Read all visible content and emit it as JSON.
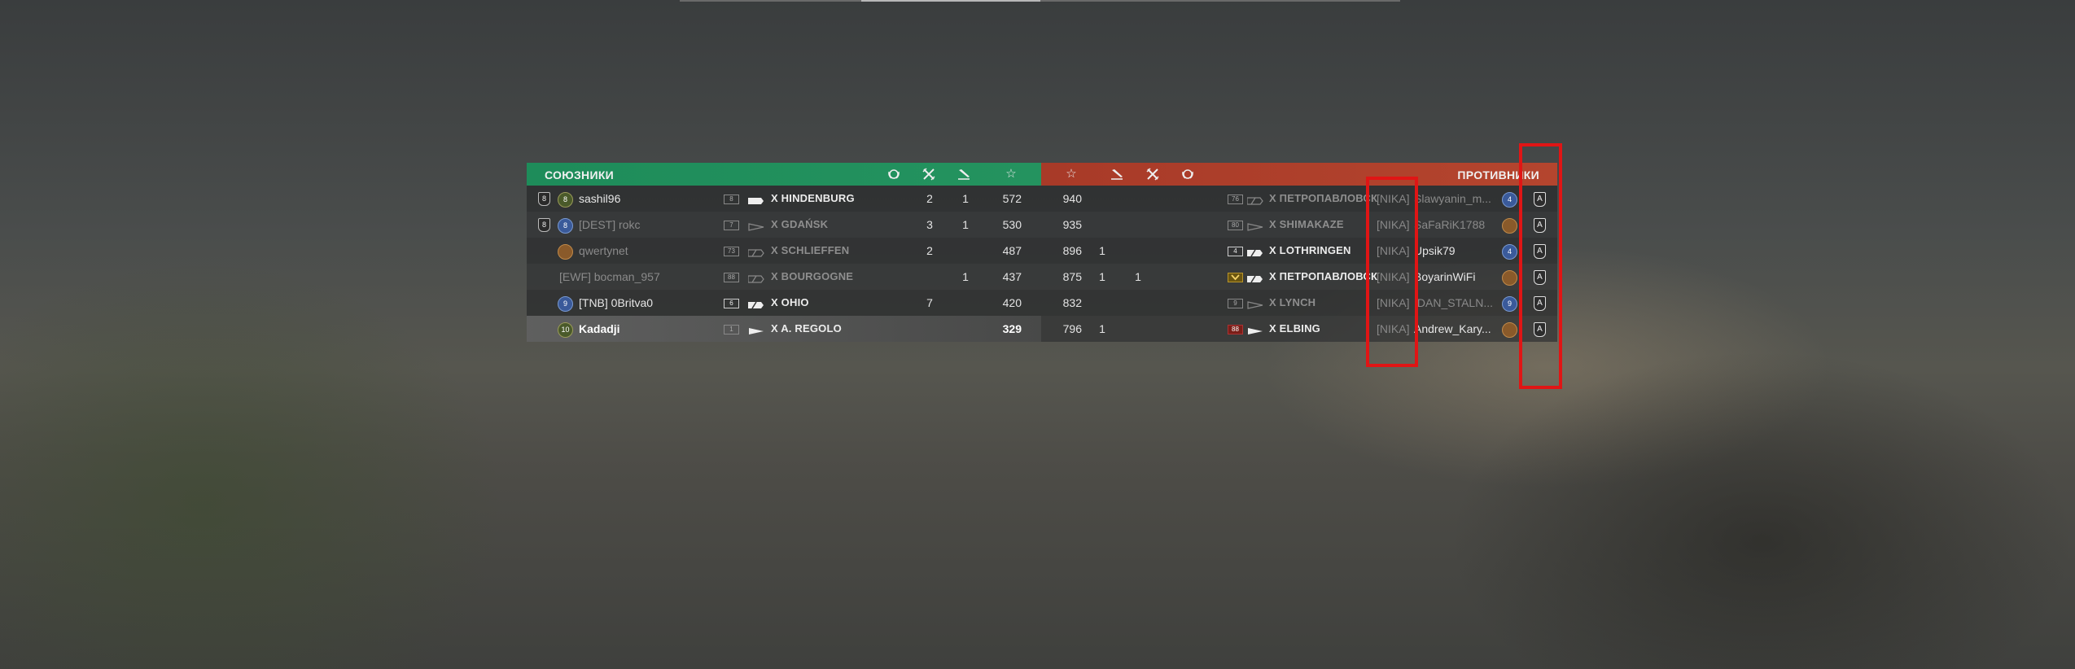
{
  "allies": {
    "title": "СОЮЗНИКИ",
    "header_icons": [
      "laurel-icon",
      "planes-crossed-icon",
      "ship-sunk-icon",
      "star-icon"
    ],
    "rows": [
      {
        "rank": "8",
        "level": "8",
        "level_color": "#4a5a2a",
        "name": "sashil96",
        "name_style": "",
        "tier": "8",
        "tier_style": "",
        "class": "cruiser",
        "ship": "X HINDENBURG",
        "ship_style": "",
        "kills": "2",
        "sunk": "1",
        "score": "572",
        "me": false,
        "alt": false
      },
      {
        "rank": "8",
        "level": "8",
        "level_color": "#3a5a9a",
        "name": "[DEST] rokc",
        "name_style": "dim",
        "tier": "7",
        "tier_style": "",
        "class": "destroyer",
        "ship": "X GDAŃSK",
        "ship_style": "dim",
        "kills": "3",
        "sunk": "1",
        "score": "530",
        "me": false,
        "alt": true
      },
      {
        "rank": "",
        "level": "",
        "level_color": "#8a5a2a",
        "name": "qwertynet",
        "name_style": "dim",
        "tier": "73",
        "tier_style": "",
        "class": "battleship",
        "ship": "X SCHLIEFFEN",
        "ship_style": "dim",
        "kills": "2",
        "sunk": "",
        "score": "487",
        "me": false,
        "alt": false
      },
      {
        "rank": "",
        "level": "",
        "level_color": "",
        "name": "[EWF] bocman_957",
        "name_style": "dim",
        "tier": "88",
        "tier_style": "",
        "class": "battleship",
        "ship": "X BOURGOGNE",
        "ship_style": "dim",
        "kills": "",
        "sunk": "1",
        "score": "437",
        "me": false,
        "alt": true
      },
      {
        "rank": "",
        "level": "9",
        "level_color": "#3a5a9a",
        "name": "[TNB] 0Britva0",
        "name_style": "",
        "tier": "6",
        "tier_style": "bright",
        "class": "battleship",
        "ship": "X OHIO",
        "ship_style": "",
        "kills": "7",
        "sunk": "",
        "score": "420",
        "me": false,
        "alt": false
      },
      {
        "rank": "",
        "level": "10",
        "level_color": "#4a5a2a",
        "name": "Kadadji",
        "name_style": "bold",
        "tier": "1",
        "tier_style": "",
        "class": "destroyer",
        "ship": "X A. REGOLO",
        "ship_style": "",
        "kills": "",
        "sunk": "",
        "score": "329",
        "me": true,
        "alt": false
      }
    ]
  },
  "enemies": {
    "title": "ПРОТИВНИКИ",
    "header_icons": [
      "star-icon",
      "ship-sunk-icon",
      "planes-crossed-icon",
      "laurel-icon"
    ],
    "rows": [
      {
        "score": "940",
        "sunk": "",
        "kills": "",
        "tier": "76",
        "tier_style": "",
        "class": "battleship",
        "ship": "X ПЕТРОПАВЛОВСК",
        "ship_style": "dim",
        "clan": "[NIKA]",
        "name": "Slawyanin_m...",
        "name_style": "dim",
        "level": "4",
        "level_color": "#3a5a9a",
        "badge": "A"
      },
      {
        "score": "935",
        "sunk": "",
        "kills": "",
        "tier": "80",
        "tier_style": "",
        "class": "destroyer",
        "ship": "X SHIMAKAZE",
        "ship_style": "dim",
        "clan": "[NIKA]",
        "name": "SaFaRiK1788",
        "name_style": "dim",
        "level": "",
        "level_color": "#8a5a2a",
        "badge": "A"
      },
      {
        "score": "896",
        "sunk": "1",
        "kills": "",
        "tier": "4",
        "tier_style": "bright",
        "class": "battleship",
        "ship": "X LOTHRINGEN",
        "ship_style": "",
        "clan": "[NIKA]",
        "name": "Upsik79",
        "name_style": "",
        "level": "4",
        "level_color": "#3a5a9a",
        "badge": "A"
      },
      {
        "score": "875",
        "sunk": "1",
        "kills": "1",
        "tier": "",
        "tier_style": "amber",
        "class": "battleship",
        "ship": "X ПЕТРОПАВЛОВСК",
        "ship_style": "",
        "clan": "[NIKA]",
        "name": "BoyarinWiFi",
        "name_style": "",
        "level": "",
        "level_color": "#8a5a2a",
        "badge": "A"
      },
      {
        "score": "832",
        "sunk": "",
        "kills": "",
        "tier": "9",
        "tier_style": "",
        "class": "destroyer",
        "ship": "X LYNCH",
        "ship_style": "dim",
        "clan": "[NIKA]",
        "name": "IDAN_STALN...",
        "name_style": "dim",
        "level": "9",
        "level_color": "#3a5a9a",
        "badge": "A"
      },
      {
        "score": "796",
        "sunk": "1",
        "kills": "",
        "tier": "88",
        "tier_style": "red",
        "class": "destroyer",
        "ship": "X ELBING",
        "ship_style": "",
        "clan": "[NIKA]",
        "name": "Andrew_Kary...",
        "name_style": "",
        "level": "",
        "level_color": "#8a5a2a",
        "badge": "A"
      }
    ]
  },
  "colors": {
    "allies_header": "#1e8c5a",
    "enemies_header": "#a83a28",
    "highlight": "#e01515"
  }
}
